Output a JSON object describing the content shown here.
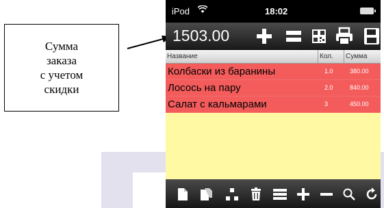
{
  "callout": {
    "text": "Сумма\nзаказа\nс учетом\nскидки"
  },
  "status_bar": {
    "carrier": "iPod",
    "time": "18:02"
  },
  "toolbar": {
    "total": "1503.00"
  },
  "table": {
    "columns": [
      "Название",
      "Кол.",
      "Сумма"
    ],
    "rows": [
      {
        "name": "Колбаски из баранины",
        "qty": "1.0",
        "sum": "380.00"
      },
      {
        "name": "Лосось на пару",
        "qty": "2.0",
        "sum": "840.00"
      },
      {
        "name": "Салат с кальмарами",
        "qty": "3",
        "sum": "450.00"
      }
    ]
  },
  "colors": {
    "row_bg": "#f45c5c",
    "list_bg": "#fff9a3",
    "bar_bg": "#2a2a2a"
  },
  "icons": {
    "toolbar": [
      "plus-icon",
      "equals-icon",
      "qr-code-icon",
      "printer-icon",
      "save-icon"
    ],
    "bottom": [
      "new-document-icon",
      "copy-document-icon",
      "hierarchy-icon",
      "trash-icon",
      "list-icon",
      "plus-icon",
      "minus-icon",
      "search-icon",
      "refresh-icon"
    ]
  }
}
